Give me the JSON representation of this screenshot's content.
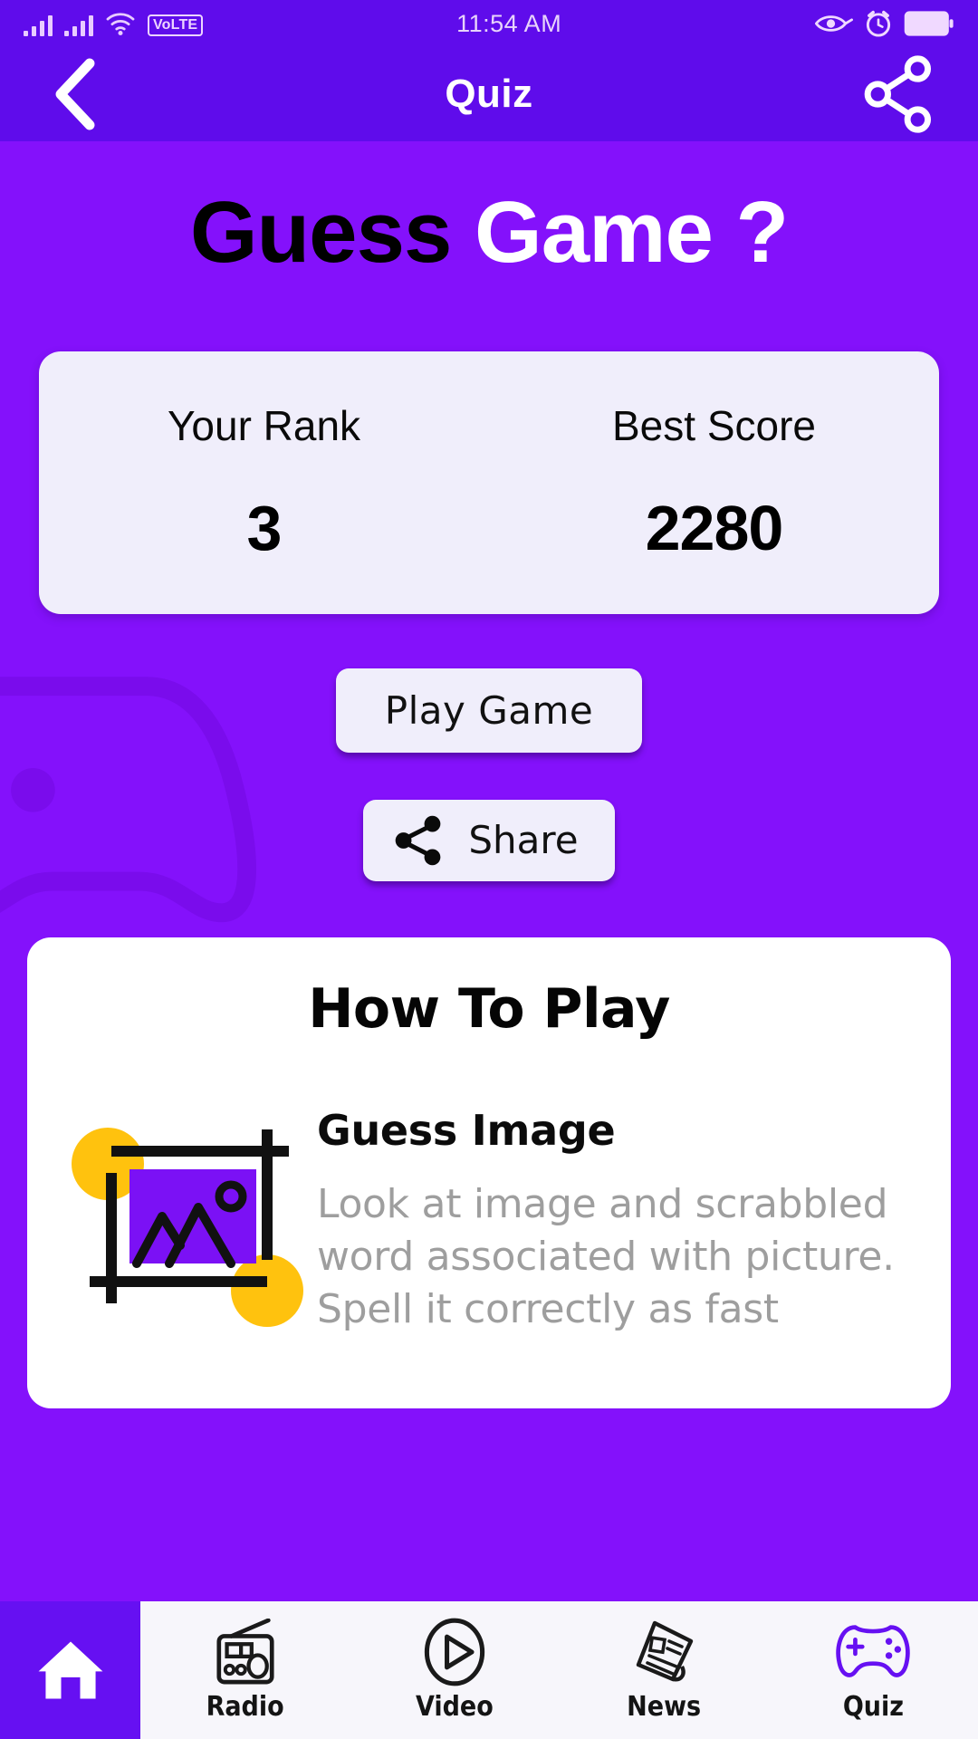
{
  "status_bar": {
    "time": "11:54 AM",
    "volte_label": "VoLTE",
    "icons": [
      "signal-bars-sim1",
      "signal-bars-sim2",
      "wifi-icon",
      "volte-badge",
      "eye-icon",
      "alarm-icon",
      "battery-icon"
    ]
  },
  "app_bar": {
    "title": "Quiz",
    "back_icon": "chevron-left-icon",
    "share_icon": "share-icon"
  },
  "hero": {
    "title_dark": "Guess",
    "title_light": "Game ?"
  },
  "score_card": {
    "rank_label": "Your Rank",
    "rank_value": "3",
    "best_label": "Best Score",
    "best_value": "2280"
  },
  "actions": {
    "play_label": "Play Game",
    "share_label": "Share"
  },
  "how_to_play": {
    "title": "How To Play",
    "items": [
      {
        "heading": "Guess Image",
        "body": "Look at image and scrabbled word associated with picture. Spell it correctly as fast",
        "illustration": "image-crop-frame-icon"
      }
    ]
  },
  "bottom_nav": {
    "home_icon": "home-icon",
    "items": [
      {
        "label": "Radio",
        "icon": "radio-icon",
        "active": false
      },
      {
        "label": "Video",
        "icon": "play-circle-icon",
        "active": false
      },
      {
        "label": "News",
        "icon": "newspaper-icon",
        "active": false
      },
      {
        "label": "Quiz",
        "icon": "gamepad-icon",
        "active": true
      }
    ]
  },
  "colors": {
    "status_bar_purple": "#5f0ceb",
    "body_purple": "#8411fb",
    "card_lavender": "#f0eefb",
    "accent_yellow": "#ffc107",
    "accent_purple": "#6610f2",
    "muted_text": "#9e9e9e"
  }
}
